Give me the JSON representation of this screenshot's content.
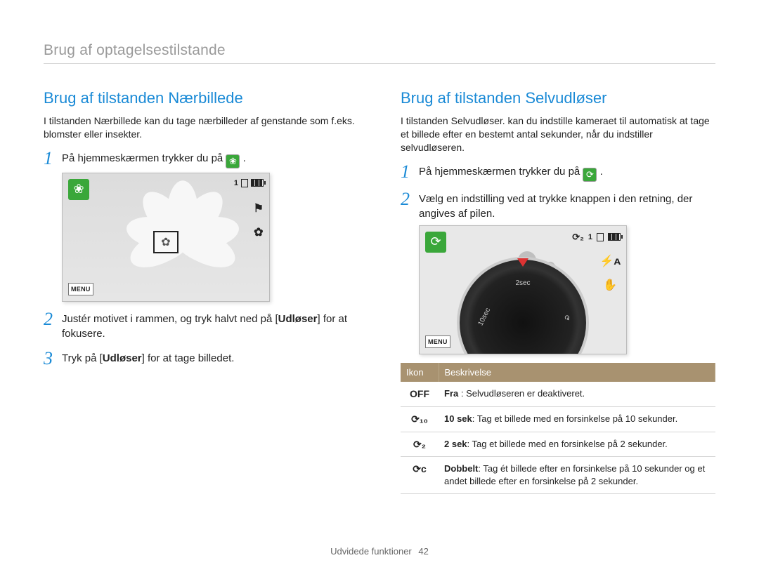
{
  "header": {
    "title": "Brug af optagelsestilstande"
  },
  "left": {
    "title": "Brug af tilstanden Nærbillede",
    "intro": "I tilstanden Nærbillede kan du tage nærbilleder af genstande som f.eks. blomster eller insekter.",
    "steps": [
      {
        "num": "1",
        "prefix": "På hjemmeskærmen trykker du på ",
        "icon": "macro-icon",
        "suffix": " ."
      },
      {
        "num": "2",
        "text_a": "Justér motivet i rammen, og tryk halvt ned på [",
        "bold": "Udløser",
        "text_b": "] for at fokusere."
      },
      {
        "num": "3",
        "text_a": "Tryk på [",
        "bold": "Udløser",
        "text_b": "] for at tage billedet."
      }
    ],
    "screen": {
      "mode_icon": "macro-icon",
      "menu_label": "MENU",
      "osd_count": "1",
      "side_icons": [
        "⚑",
        "✿"
      ]
    }
  },
  "right": {
    "title": "Brug af tilstanden Selvudløser",
    "intro": "I tilstanden Selvudløser. kan du indstille kameraet til automatisk at tage et billede efter en bestemt antal sekunder, når du indstiller selvudløseren.",
    "steps": [
      {
        "num": "1",
        "prefix": "På hjemmeskærmen trykker du på ",
        "icon": "timer-icon",
        "suffix": " ."
      },
      {
        "num": "2",
        "text": "Vælg en indstilling ved at trykke knappen i den retning, der angives af pilen."
      }
    ],
    "screen": {
      "mode_icon": "timer-icon",
      "menu_label": "MENU",
      "osd_timer_glyph": "⟳₂",
      "osd_count": "1",
      "side_icons": [
        "⚡ᴀ",
        "✋"
      ],
      "dial": {
        "l_top": "2sec",
        "l_left": "10sec",
        "l_right": "⟳"
      }
    },
    "table": {
      "head": {
        "col1": "Ikon",
        "col2": "Beskrivelse"
      },
      "rows": [
        {
          "icon": "OFF",
          "desc_bold": "Fra",
          "desc_rest": " : Selvudløseren er deaktiveret."
        },
        {
          "icon": "⟳₁₀",
          "desc_bold": "10 sek",
          "desc_rest": ": Tag et billede med en forsinkelse på 10 sekunder."
        },
        {
          "icon": "⟳₂",
          "desc_bold": "2 sek",
          "desc_rest": ": Tag et billede med en forsinkelse på 2 sekunder."
        },
        {
          "icon": "⟳ᴄ",
          "desc_bold": "Dobbelt",
          "desc_rest": ": Tag ét billede efter en forsinkelse på 10 sekunder og et andet billede efter en forsinkelse på 2 sekunder."
        }
      ]
    }
  },
  "footer": {
    "section": "Udvidede funktioner",
    "page": "42"
  }
}
